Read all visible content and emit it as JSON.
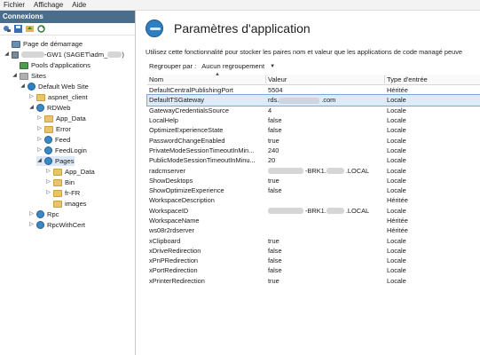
{
  "menu": {
    "items": [
      "Fichier",
      "Affichage",
      "Aide"
    ]
  },
  "left_panel": {
    "title": "Connexions",
    "toolbar_icons": [
      "connect-icon",
      "save-icon",
      "up-icon",
      "refresh-icon"
    ],
    "tree": {
      "home": "Page de démarrage",
      "server_prefix": "",
      "server_suffix": "-GW1 (SAGET\\adm_",
      "server_close": ")",
      "pools": "Pools d'applications",
      "sites": "Sites",
      "default_site": "Default Web Site",
      "aspnet": "aspnet_client",
      "rdweb": "RDWeb",
      "app_data": "App_Data",
      "error": "Error",
      "feed": "Feed",
      "feedlogin": "FeedLogin",
      "pages": "Pages",
      "pages_app_data": "App_Data",
      "pages_bin": "Bin",
      "pages_frfr": "fr-FR",
      "pages_images": "images",
      "rpc": "Rpc",
      "rpcwithcert": "RpcWithCert"
    }
  },
  "right_panel": {
    "title": "Paramètres d'application",
    "description": "Utilisez cette fonctionnalité pour stocker les paires nom et valeur que les applications de code managé peuve",
    "group_label": "Regrouper par :",
    "group_value": "Aucun regroupement",
    "columns": {
      "name": "Nom",
      "value": "Valeur",
      "type": "Type d'entrée"
    },
    "rows": [
      {
        "name": "DefaultCentralPublishingPort",
        "value_pre": "5504",
        "value_post": "",
        "type": "Héritée"
      },
      {
        "name": "DefaultTSGateway",
        "value_pre": "rds.",
        "value_post": ".com",
        "type": "Locale"
      },
      {
        "name": "GatewayCredentialsSource",
        "value_pre": "4",
        "value_post": "",
        "type": "Locale"
      },
      {
        "name": "LocalHelp",
        "value_pre": "false",
        "value_post": "",
        "type": "Locale"
      },
      {
        "name": "OptimizeExperienceState",
        "value_pre": "false",
        "value_post": "",
        "type": "Locale"
      },
      {
        "name": "PasswordChangeEnabled",
        "value_pre": "true",
        "value_post": "",
        "type": "Locale"
      },
      {
        "name": "PrivateModeSessionTimeoutInMin...",
        "value_pre": "240",
        "value_post": "",
        "type": "Locale"
      },
      {
        "name": "PublicModeSessionTimeoutInMinu...",
        "value_pre": "20",
        "value_post": "",
        "type": "Locale"
      },
      {
        "name": "radcmserver",
        "value_pre": "",
        "value_post": "-BRK1.",
        "value_post2": ".LOCAL",
        "type": "Locale"
      },
      {
        "name": "ShowDesktops",
        "value_pre": "true",
        "value_post": "",
        "type": "Locale"
      },
      {
        "name": "ShowOptimizeExperience",
        "value_pre": "false",
        "value_post": "",
        "type": "Locale"
      },
      {
        "name": "WorkspaceDescription",
        "value_pre": "",
        "value_post": "",
        "type": "Héritée"
      },
      {
        "name": "WorkspaceID",
        "value_pre": "",
        "value_post": "-BRK1.",
        "value_post2": ".LOCAL",
        "type": "Locale"
      },
      {
        "name": "WorkspaceName",
        "value_pre": "",
        "value_post": "",
        "type": "Héritée"
      },
      {
        "name": "ws08r2rdserver",
        "value_pre": "",
        "value_post": "",
        "type": "Héritée"
      },
      {
        "name": "xClipboard",
        "value_pre": "true",
        "value_post": "",
        "type": "Locale"
      },
      {
        "name": "xDriveRedirection",
        "value_pre": "false",
        "value_post": "",
        "type": "Locale"
      },
      {
        "name": "xPnPRedirection",
        "value_pre": "false",
        "value_post": "",
        "type": "Locale"
      },
      {
        "name": "xPortRedirection",
        "value_pre": "false",
        "value_post": "",
        "type": "Locale"
      },
      {
        "name": "xPrinterRedirection",
        "value_pre": "true",
        "value_post": "",
        "type": "Locale"
      }
    ],
    "selected_row": "DefaultTSGateway"
  },
  "colors": {
    "title_bar": "#4a6d8c",
    "selection": "#ddebf8",
    "folder": "#e9c46a"
  }
}
